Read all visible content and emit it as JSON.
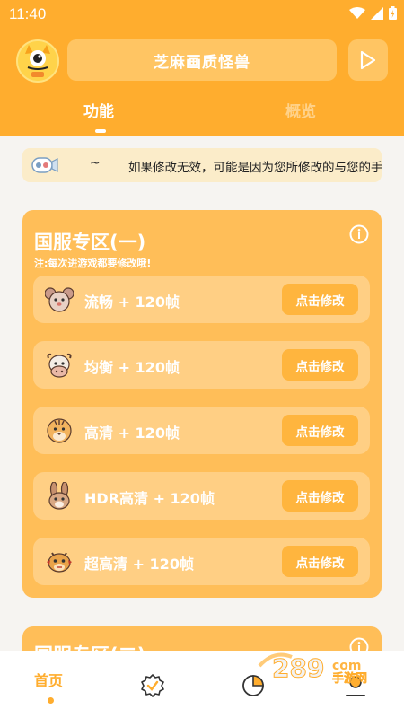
{
  "status": {
    "time": "11:40"
  },
  "header": {
    "title": "芝麻画质怪兽"
  },
  "tabs": [
    {
      "label": "功能"
    },
    {
      "label": "概览"
    }
  ],
  "notice": {
    "tilde": "~",
    "text": "如果修改无效，可能是因为您所修改的与您的手"
  },
  "sections": [
    {
      "title": "国服专区(一)",
      "note": "注:每次进游戏都要修改哦!",
      "rows": [
        {
          "label": "流畅 + 120帧",
          "animal": "mouse-icon",
          "button": "点击修改"
        },
        {
          "label": "均衡 + 120帧",
          "animal": "cow-icon",
          "button": "点击修改"
        },
        {
          "label": "高清 + 120帧",
          "animal": "tiger-icon",
          "button": "点击修改"
        },
        {
          "label": "HDR高清 + 120帧",
          "animal": "rabbit-icon",
          "button": "点击修改"
        },
        {
          "label": "超高清 + 120帧",
          "animal": "dragon-icon",
          "button": "点击修改"
        }
      ]
    },
    {
      "title": "国服专区(二)"
    }
  ],
  "nav": {
    "home": "首页"
  },
  "colors": {
    "accent": "#ffad2e",
    "card": "#ffbe58",
    "row": "#ffcf84",
    "button": "#ffb53e"
  }
}
